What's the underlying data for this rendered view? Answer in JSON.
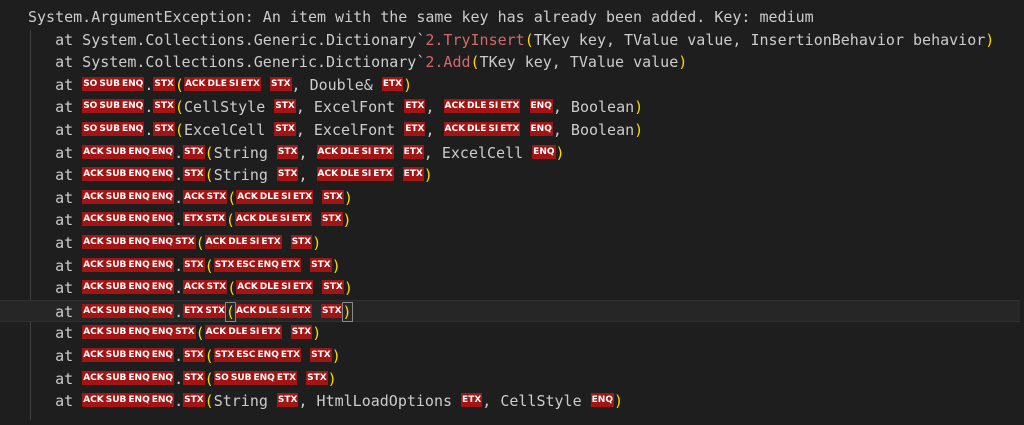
{
  "lines": [
    [
      {
        "t": "text",
        "v": "System.ArgumentException: An item with the same key has already been added. Key: medium"
      }
    ],
    [
      {
        "t": "text",
        "v": "   at System.Collections.Generic.Dictionary`"
      },
      {
        "t": "method",
        "v": "2.TryInsert"
      },
      {
        "t": "paren",
        "v": "("
      },
      {
        "t": "text",
        "v": "TKey key, TValue value, InsertionBehavior behavior"
      },
      {
        "t": "paren",
        "v": ")"
      }
    ],
    [
      {
        "t": "text",
        "v": "   at System.Collections.Generic.Dictionary`"
      },
      {
        "t": "method",
        "v": "2.Add"
      },
      {
        "t": "paren",
        "v": "("
      },
      {
        "t": "text",
        "v": "TKey key, TValue value"
      },
      {
        "t": "paren",
        "v": ")"
      }
    ],
    [
      {
        "t": "text",
        "v": "   at "
      },
      {
        "t": "ctl",
        "v": "SO"
      },
      {
        "t": "ctl",
        "v": "SUB"
      },
      {
        "t": "ctl",
        "v": "ENQ"
      },
      {
        "t": "text",
        "v": "."
      },
      {
        "t": "ctl",
        "v": "STX"
      },
      {
        "t": "paren",
        "v": "("
      },
      {
        "t": "ctl",
        "v": "ACK"
      },
      {
        "t": "ctl",
        "v": "DLE"
      },
      {
        "t": "ctl",
        "v": "SI"
      },
      {
        "t": "ctl",
        "v": "ETX"
      },
      {
        "t": "text",
        "v": " "
      },
      {
        "t": "ctl",
        "v": "STX"
      },
      {
        "t": "text",
        "v": ", Double& "
      },
      {
        "t": "ctl",
        "v": "ETX"
      },
      {
        "t": "paren",
        "v": ")"
      }
    ],
    [
      {
        "t": "text",
        "v": "   at "
      },
      {
        "t": "ctl",
        "v": "SO"
      },
      {
        "t": "ctl",
        "v": "SUB"
      },
      {
        "t": "ctl",
        "v": "ENQ"
      },
      {
        "t": "text",
        "v": "."
      },
      {
        "t": "ctl",
        "v": "STX"
      },
      {
        "t": "paren",
        "v": "("
      },
      {
        "t": "text",
        "v": "CellStyle "
      },
      {
        "t": "ctl",
        "v": "STX"
      },
      {
        "t": "text",
        "v": ", ExcelFont "
      },
      {
        "t": "ctl",
        "v": "ETX"
      },
      {
        "t": "text",
        "v": ", "
      },
      {
        "t": "ctl",
        "v": "ACK"
      },
      {
        "t": "ctl",
        "v": "DLE"
      },
      {
        "t": "ctl",
        "v": "SI"
      },
      {
        "t": "ctl",
        "v": "ETX"
      },
      {
        "t": "text",
        "v": " "
      },
      {
        "t": "ctl",
        "v": "ENQ"
      },
      {
        "t": "text",
        "v": ", Boolean"
      },
      {
        "t": "paren",
        "v": ")"
      }
    ],
    [
      {
        "t": "text",
        "v": "   at "
      },
      {
        "t": "ctl",
        "v": "SO"
      },
      {
        "t": "ctl",
        "v": "SUB"
      },
      {
        "t": "ctl",
        "v": "ENQ"
      },
      {
        "t": "text",
        "v": "."
      },
      {
        "t": "ctl",
        "v": "STX"
      },
      {
        "t": "paren",
        "v": "("
      },
      {
        "t": "text",
        "v": "ExcelCell "
      },
      {
        "t": "ctl",
        "v": "STX"
      },
      {
        "t": "text",
        "v": ", ExcelFont "
      },
      {
        "t": "ctl",
        "v": "ETX"
      },
      {
        "t": "text",
        "v": ", "
      },
      {
        "t": "ctl",
        "v": "ACK"
      },
      {
        "t": "ctl",
        "v": "DLE"
      },
      {
        "t": "ctl",
        "v": "SI"
      },
      {
        "t": "ctl",
        "v": "ETX"
      },
      {
        "t": "text",
        "v": " "
      },
      {
        "t": "ctl",
        "v": "ENQ"
      },
      {
        "t": "text",
        "v": ", Boolean"
      },
      {
        "t": "paren",
        "v": ")"
      }
    ],
    [
      {
        "t": "text",
        "v": "   at "
      },
      {
        "t": "ctl",
        "v": "ACK"
      },
      {
        "t": "ctl",
        "v": "SUB"
      },
      {
        "t": "ctl",
        "v": "ENQ"
      },
      {
        "t": "ctl",
        "v": "ENQ"
      },
      {
        "t": "text",
        "v": "."
      },
      {
        "t": "ctl",
        "v": "STX"
      },
      {
        "t": "paren",
        "v": "("
      },
      {
        "t": "text",
        "v": "String "
      },
      {
        "t": "ctl",
        "v": "STX"
      },
      {
        "t": "text",
        "v": ", "
      },
      {
        "t": "ctl",
        "v": "ACK"
      },
      {
        "t": "ctl",
        "v": "DLE"
      },
      {
        "t": "ctl",
        "v": "SI"
      },
      {
        "t": "ctl",
        "v": "ETX"
      },
      {
        "t": "text",
        "v": " "
      },
      {
        "t": "ctl",
        "v": "ETX"
      },
      {
        "t": "text",
        "v": ", ExcelCell "
      },
      {
        "t": "ctl",
        "v": "ENQ"
      },
      {
        "t": "paren",
        "v": ")"
      }
    ],
    [
      {
        "t": "text",
        "v": "   at "
      },
      {
        "t": "ctl",
        "v": "ACK"
      },
      {
        "t": "ctl",
        "v": "SUB"
      },
      {
        "t": "ctl",
        "v": "ENQ"
      },
      {
        "t": "ctl",
        "v": "ENQ"
      },
      {
        "t": "text",
        "v": "."
      },
      {
        "t": "ctl",
        "v": "STX"
      },
      {
        "t": "paren",
        "v": "("
      },
      {
        "t": "text",
        "v": "String "
      },
      {
        "t": "ctl",
        "v": "STX"
      },
      {
        "t": "text",
        "v": ", "
      },
      {
        "t": "ctl",
        "v": "ACK"
      },
      {
        "t": "ctl",
        "v": "DLE"
      },
      {
        "t": "ctl",
        "v": "SI"
      },
      {
        "t": "ctl",
        "v": "ETX"
      },
      {
        "t": "text",
        "v": " "
      },
      {
        "t": "ctl",
        "v": "ETX"
      },
      {
        "t": "paren",
        "v": ")"
      }
    ],
    [
      {
        "t": "text",
        "v": "   at "
      },
      {
        "t": "ctl",
        "v": "ACK"
      },
      {
        "t": "ctl",
        "v": "SUB"
      },
      {
        "t": "ctl",
        "v": "ENQ"
      },
      {
        "t": "ctl",
        "v": "ENQ"
      },
      {
        "t": "text",
        "v": "."
      },
      {
        "t": "ctl",
        "v": "ACK"
      },
      {
        "t": "ctl",
        "v": "STX"
      },
      {
        "t": "paren",
        "v": "("
      },
      {
        "t": "ctl",
        "v": "ACK"
      },
      {
        "t": "ctl",
        "v": "DLE"
      },
      {
        "t": "ctl",
        "v": "SI"
      },
      {
        "t": "ctl",
        "v": "ETX"
      },
      {
        "t": "text",
        "v": " "
      },
      {
        "t": "ctl",
        "v": "STX"
      },
      {
        "t": "paren",
        "v": ")"
      }
    ],
    [
      {
        "t": "text",
        "v": "   at "
      },
      {
        "t": "ctl",
        "v": "ACK"
      },
      {
        "t": "ctl",
        "v": "SUB"
      },
      {
        "t": "ctl",
        "v": "ENQ"
      },
      {
        "t": "ctl",
        "v": "ENQ"
      },
      {
        "t": "text",
        "v": "."
      },
      {
        "t": "ctl",
        "v": "ETX"
      },
      {
        "t": "ctl",
        "v": "STX"
      },
      {
        "t": "paren",
        "v": "("
      },
      {
        "t": "ctl",
        "v": "ACK"
      },
      {
        "t": "ctl",
        "v": "DLE"
      },
      {
        "t": "ctl",
        "v": "SI"
      },
      {
        "t": "ctl",
        "v": "ETX"
      },
      {
        "t": "text",
        "v": " "
      },
      {
        "t": "ctl",
        "v": "STX"
      },
      {
        "t": "paren",
        "v": ")"
      }
    ],
    [
      {
        "t": "text",
        "v": "   at "
      },
      {
        "t": "ctl",
        "v": "ACK"
      },
      {
        "t": "ctl",
        "v": "SUB"
      },
      {
        "t": "ctl",
        "v": "ENQ"
      },
      {
        "t": "ctl",
        "v": "ENQ"
      },
      {
        "t": "ctl",
        "v": "STX"
      },
      {
        "t": "paren",
        "v": "("
      },
      {
        "t": "ctl",
        "v": "ACK"
      },
      {
        "t": "ctl",
        "v": "DLE"
      },
      {
        "t": "ctl",
        "v": "SI"
      },
      {
        "t": "ctl",
        "v": "ETX"
      },
      {
        "t": "text",
        "v": " "
      },
      {
        "t": "ctl",
        "v": "STX"
      },
      {
        "t": "paren",
        "v": ")"
      }
    ],
    [
      {
        "t": "text",
        "v": "   at "
      },
      {
        "t": "ctl",
        "v": "ACK"
      },
      {
        "t": "ctl",
        "v": "SUB"
      },
      {
        "t": "ctl",
        "v": "ENQ"
      },
      {
        "t": "ctl",
        "v": "ENQ"
      },
      {
        "t": "text",
        "v": "."
      },
      {
        "t": "ctl",
        "v": "STX"
      },
      {
        "t": "paren",
        "v": "("
      },
      {
        "t": "ctl",
        "v": "STX"
      },
      {
        "t": "ctl",
        "v": "ESC"
      },
      {
        "t": "ctl",
        "v": "ENQ"
      },
      {
        "t": "ctl",
        "v": "ETX"
      },
      {
        "t": "text",
        "v": " "
      },
      {
        "t": "ctl",
        "v": "STX"
      },
      {
        "t": "paren",
        "v": ")"
      }
    ],
    [
      {
        "t": "text",
        "v": "   at "
      },
      {
        "t": "ctl",
        "v": "ACK"
      },
      {
        "t": "ctl",
        "v": "SUB"
      },
      {
        "t": "ctl",
        "v": "ENQ"
      },
      {
        "t": "ctl",
        "v": "ENQ"
      },
      {
        "t": "text",
        "v": "."
      },
      {
        "t": "ctl",
        "v": "ACK"
      },
      {
        "t": "ctl",
        "v": "STX"
      },
      {
        "t": "paren",
        "v": "("
      },
      {
        "t": "ctl",
        "v": "ACK"
      },
      {
        "t": "ctl",
        "v": "DLE"
      },
      {
        "t": "ctl",
        "v": "SI"
      },
      {
        "t": "ctl",
        "v": "ETX"
      },
      {
        "t": "text",
        "v": " "
      },
      {
        "t": "ctl",
        "v": "STX"
      },
      {
        "t": "paren",
        "v": ")"
      }
    ],
    [
      {
        "t": "text",
        "v": "   at "
      },
      {
        "t": "ctl",
        "v": "ACK"
      },
      {
        "t": "ctl",
        "v": "SUB"
      },
      {
        "t": "ctl",
        "v": "ENQ"
      },
      {
        "t": "ctl",
        "v": "ENQ"
      },
      {
        "t": "text",
        "v": "."
      },
      {
        "t": "ctl",
        "v": "ETX"
      },
      {
        "t": "ctl",
        "v": "STX"
      },
      {
        "t": "parenm",
        "v": "("
      },
      {
        "t": "ctl",
        "v": "ACK"
      },
      {
        "t": "ctl",
        "v": "DLE"
      },
      {
        "t": "ctl",
        "v": "SI"
      },
      {
        "t": "ctl",
        "v": "ETX"
      },
      {
        "t": "text",
        "v": " "
      },
      {
        "t": "ctl",
        "v": "STX"
      },
      {
        "t": "parenm",
        "v": ")"
      }
    ],
    [
      {
        "t": "text",
        "v": "   at "
      },
      {
        "t": "ctl",
        "v": "ACK"
      },
      {
        "t": "ctl",
        "v": "SUB"
      },
      {
        "t": "ctl",
        "v": "ENQ"
      },
      {
        "t": "ctl",
        "v": "ENQ"
      },
      {
        "t": "ctl",
        "v": "STX"
      },
      {
        "t": "paren",
        "v": "("
      },
      {
        "t": "ctl",
        "v": "ACK"
      },
      {
        "t": "ctl",
        "v": "DLE"
      },
      {
        "t": "ctl",
        "v": "SI"
      },
      {
        "t": "ctl",
        "v": "ETX"
      },
      {
        "t": "text",
        "v": " "
      },
      {
        "t": "ctl",
        "v": "STX"
      },
      {
        "t": "paren",
        "v": ")"
      }
    ],
    [
      {
        "t": "text",
        "v": "   at "
      },
      {
        "t": "ctl",
        "v": "ACK"
      },
      {
        "t": "ctl",
        "v": "SUB"
      },
      {
        "t": "ctl",
        "v": "ENQ"
      },
      {
        "t": "ctl",
        "v": "ENQ"
      },
      {
        "t": "text",
        "v": "."
      },
      {
        "t": "ctl",
        "v": "STX"
      },
      {
        "t": "paren",
        "v": "("
      },
      {
        "t": "ctl",
        "v": "STX"
      },
      {
        "t": "ctl",
        "v": "ESC"
      },
      {
        "t": "ctl",
        "v": "ENQ"
      },
      {
        "t": "ctl",
        "v": "ETX"
      },
      {
        "t": "text",
        "v": " "
      },
      {
        "t": "ctl",
        "v": "STX"
      },
      {
        "t": "paren",
        "v": ")"
      }
    ],
    [
      {
        "t": "text",
        "v": "   at "
      },
      {
        "t": "ctl",
        "v": "ACK"
      },
      {
        "t": "ctl",
        "v": "SUB"
      },
      {
        "t": "ctl",
        "v": "ENQ"
      },
      {
        "t": "ctl",
        "v": "ENQ"
      },
      {
        "t": "text",
        "v": "."
      },
      {
        "t": "ctl",
        "v": "STX"
      },
      {
        "t": "paren",
        "v": "("
      },
      {
        "t": "ctl",
        "v": "SO"
      },
      {
        "t": "ctl",
        "v": "SUB"
      },
      {
        "t": "ctl",
        "v": "ENQ"
      },
      {
        "t": "ctl",
        "v": "ETX"
      },
      {
        "t": "text",
        "v": " "
      },
      {
        "t": "ctl",
        "v": "STX"
      },
      {
        "t": "paren",
        "v": ")"
      }
    ],
    [
      {
        "t": "text",
        "v": "   at "
      },
      {
        "t": "ctl",
        "v": "ACK"
      },
      {
        "t": "ctl",
        "v": "SUB"
      },
      {
        "t": "ctl",
        "v": "ENQ"
      },
      {
        "t": "ctl",
        "v": "ENQ"
      },
      {
        "t": "text",
        "v": "."
      },
      {
        "t": "ctl",
        "v": "STX"
      },
      {
        "t": "paren",
        "v": "("
      },
      {
        "t": "text",
        "v": "String "
      },
      {
        "t": "ctl",
        "v": "STX"
      },
      {
        "t": "text",
        "v": ", HtmlLoadOptions "
      },
      {
        "t": "ctl",
        "v": "ETX"
      },
      {
        "t": "text",
        "v": ", CellStyle "
      },
      {
        "t": "ctl",
        "v": "ENQ"
      },
      {
        "t": "paren",
        "v": ")"
      }
    ]
  ],
  "current_line": 13,
  "colors": {
    "background": "#1e1e1e",
    "text": "#cccccc",
    "method": "#d16969",
    "paren": "#ffd700",
    "control_char_bg": "#a31515"
  }
}
